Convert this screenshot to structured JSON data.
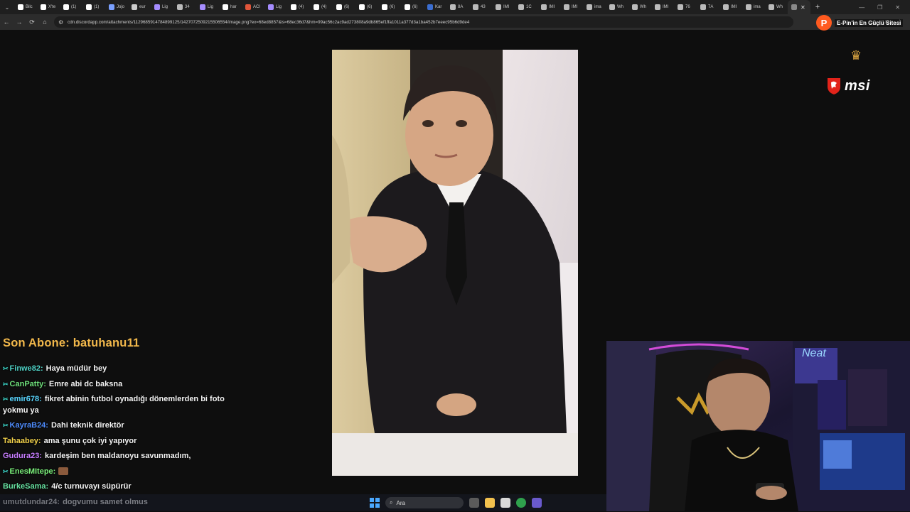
{
  "browser": {
    "tabs": [
      {
        "label": "Bilc",
        "icon": "x-logo-icon",
        "color": "#ffffff"
      },
      {
        "label": "X'te",
        "icon": "x-logo-icon",
        "color": "#ffffff"
      },
      {
        "label": "(1)",
        "icon": "x-logo-icon",
        "color": "#ffffff"
      },
      {
        "label": "(1)",
        "icon": "x-logo-icon",
        "color": "#ffffff"
      },
      {
        "label": "Jojo",
        "icon": "site-icon",
        "color": "#7aa0ff"
      },
      {
        "label": "eur",
        "icon": "globe-icon",
        "color": "#cccccc"
      },
      {
        "label": "Lig",
        "icon": "feather-icon",
        "color": "#a58cff"
      },
      {
        "label": "34",
        "icon": "globe-icon",
        "color": "#bbbbbb"
      },
      {
        "label": "Lig",
        "icon": "feather-icon",
        "color": "#a58cff"
      },
      {
        "label": "har",
        "icon": "google-icon",
        "color": "#ffffff"
      },
      {
        "label": "ACI",
        "icon": "site-icon",
        "color": "#e0553a"
      },
      {
        "label": "Lig",
        "icon": "feather-icon",
        "color": "#a58cff"
      },
      {
        "label": "(4)",
        "icon": "x-logo-icon",
        "color": "#ffffff"
      },
      {
        "label": "(4)",
        "icon": "x-logo-icon",
        "color": "#ffffff"
      },
      {
        "label": "(6)",
        "icon": "x-logo-icon",
        "color": "#ffffff"
      },
      {
        "label": "(6)",
        "icon": "x-logo-icon",
        "color": "#ffffff"
      },
      {
        "label": "(6)",
        "icon": "x-logo-icon",
        "color": "#ffffff"
      },
      {
        "label": "(6)",
        "icon": "x-logo-icon",
        "color": "#ffffff"
      },
      {
        "label": "Kar",
        "icon": "site-icon",
        "color": "#3b6ed1"
      },
      {
        "label": "8A",
        "icon": "globe-icon",
        "color": "#bbbbbb"
      },
      {
        "label": "43",
        "icon": "globe-icon",
        "color": "#bbbbbb"
      },
      {
        "label": "IMI",
        "icon": "globe-icon",
        "color": "#bbbbbb"
      },
      {
        "label": "1C",
        "icon": "globe-icon",
        "color": "#bbbbbb"
      },
      {
        "label": "IMI",
        "icon": "globe-icon",
        "color": "#bbbbbb"
      },
      {
        "label": "IMI",
        "icon": "globe-icon",
        "color": "#bbbbbb"
      },
      {
        "label": "ima",
        "icon": "globe-icon",
        "color": "#bbbbbb"
      },
      {
        "label": "Wh",
        "icon": "globe-icon",
        "color": "#bbbbbb"
      },
      {
        "label": "Wh",
        "icon": "globe-icon",
        "color": "#bbbbbb"
      },
      {
        "label": "IMI",
        "icon": "globe-icon",
        "color": "#bbbbbb"
      },
      {
        "label": "76",
        "icon": "globe-icon",
        "color": "#bbbbbb"
      },
      {
        "label": "7A",
        "icon": "globe-icon",
        "color": "#bbbbbb"
      },
      {
        "label": "IMI",
        "icon": "globe-icon",
        "color": "#bbbbbb"
      },
      {
        "label": "ima",
        "icon": "globe-icon",
        "color": "#bbbbbb"
      },
      {
        "label": "Wh",
        "icon": "globe-icon",
        "color": "#bbbbbb"
      }
    ],
    "active_tab_close": "✕",
    "new_tab": "+",
    "url": "cdn.discordapp.com/attachments/1129685914784899125/1427072509215506554/image.png?ex=68ed8857&is=68ec36d7&hm=99ac56c2ac9ad273808a9db865ef1ffa1011a377d3a1ba452b7eeec95b6d9de4"
  },
  "overlay": {
    "promo_text": "E-Pin'in En Güçlü Sitesi",
    "promo_badge": "P",
    "brand": "msi"
  },
  "stream": {
    "last_sub_label": "Son Abone: batuhanu11"
  },
  "chat": [
    {
      "badge": "✂",
      "user": "Finwe82:",
      "user_color": "#4fd1c5",
      "text": "Haya müdür bey"
    },
    {
      "badge": "✂",
      "user": "CanPatty:",
      "user_color": "#6ee07a",
      "text": "Emre abi dc baksna"
    },
    {
      "badge": "✂",
      "user": "emir678:",
      "user_color": "#5ad6ff",
      "text": "fikret abinin futbol oynadığı dönemlerden bi foto yokmu ya"
    },
    {
      "badge": "✂",
      "user": "KayraB24:",
      "user_color": "#4f8dff",
      "text": "Dahi teknik direktör"
    },
    {
      "badge": "",
      "user": "Tahaabey:",
      "user_color": "#f2d14a",
      "text": "ama şunu çok iyi yapıyor"
    },
    {
      "badge": "",
      "user": "Gudura23:",
      "user_color": "#c77dff",
      "text": "kardeşim ben maldanoyu savunmadım,"
    },
    {
      "badge": "✂",
      "user": "EnesMItepe:",
      "user_color": "#7cf27c",
      "text": ""
    },
    {
      "badge": "",
      "user": "BurkeSama:",
      "user_color": "#66e0a0",
      "text": "4/c turnuvayı süpürür"
    },
    {
      "badge": "",
      "user": "umutdundar24:",
      "user_color": "#e0e0e0",
      "text": "dogvumu samet olmus"
    }
  ],
  "taskbar": {
    "search_placeholder": "Ara"
  }
}
